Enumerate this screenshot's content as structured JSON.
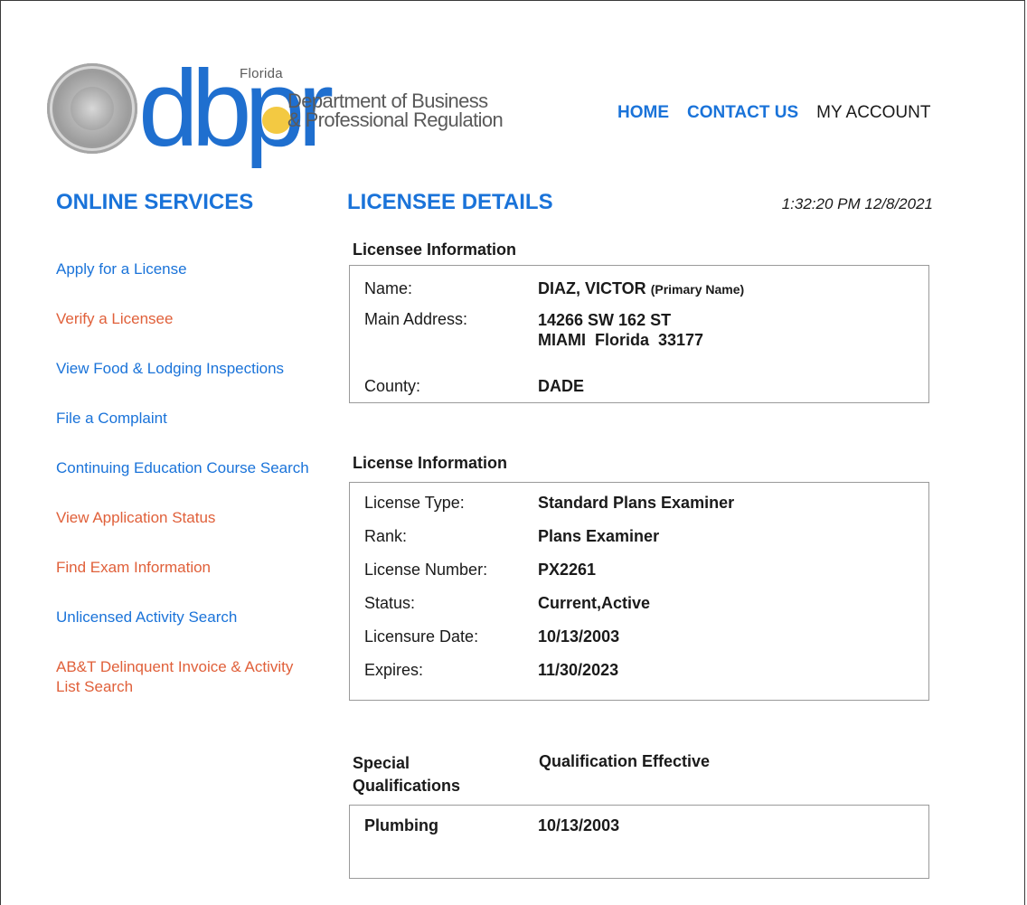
{
  "header": {
    "logo_state": "Florida",
    "logo_mark": "dbpr",
    "logo_line1": "Department of Business",
    "logo_line2": "& Professional Regulation",
    "nav": [
      {
        "label": "HOME"
      },
      {
        "label": "CONTACT US"
      },
      {
        "label": "MY ACCOUNT"
      }
    ]
  },
  "sidebar": {
    "title": "ONLINE SERVICES",
    "items": [
      {
        "label": "Apply for a License",
        "color": "#1a73d9"
      },
      {
        "label": "Verify a Licensee",
        "color": "#e0603a"
      },
      {
        "label": "View Food & Lodging Inspections",
        "color": "#1a73d9"
      },
      {
        "label": "File a Complaint",
        "color": "#1a73d9"
      },
      {
        "label": "Continuing Education Course Search",
        "color": "#1a73d9"
      },
      {
        "label": "View Application Status",
        "color": "#e0603a"
      },
      {
        "label": "Find Exam Information",
        "color": "#e0603a"
      },
      {
        "label": "Unlicensed Activity Search",
        "color": "#1a73d9"
      },
      {
        "label": "AB&T Delinquent Invoice & Activity List Search",
        "color": "#e0603a"
      }
    ]
  },
  "main": {
    "title": "LICENSEE DETAILS",
    "timestamp": "1:32:20 PM 12/8/2021",
    "licensee": {
      "heading": "Licensee Information",
      "name_label": "Name:",
      "name_value": "DIAZ, VICTOR",
      "name_note": "(Primary Name)",
      "address_label": "Main Address:",
      "address_line1": "14266 SW 162 ST",
      "address_line2": "MIAMI  Florida  33177",
      "county_label": "County:",
      "county_value": "DADE"
    },
    "license": {
      "heading": "License Information",
      "rows": [
        {
          "label": "License Type:",
          "value": "Standard Plans Examiner"
        },
        {
          "label": "Rank:",
          "value": "Plans Examiner"
        },
        {
          "label": "License Number:",
          "value": "PX2261"
        },
        {
          "label": "Status:",
          "value": "Current,Active"
        },
        {
          "label": "Licensure Date:",
          "value": "10/13/2003"
        },
        {
          "label": "Expires:",
          "value": "11/30/2023"
        }
      ]
    },
    "special": {
      "heading_line1": "Special",
      "heading_line2": "Qualifications",
      "effective_heading": "Qualification Effective",
      "qualification": "Plumbing",
      "effective_date": "10/13/2003"
    }
  },
  "colors": {
    "accent_blue": "#1a73d9",
    "accent_orange": "#e0603a"
  }
}
